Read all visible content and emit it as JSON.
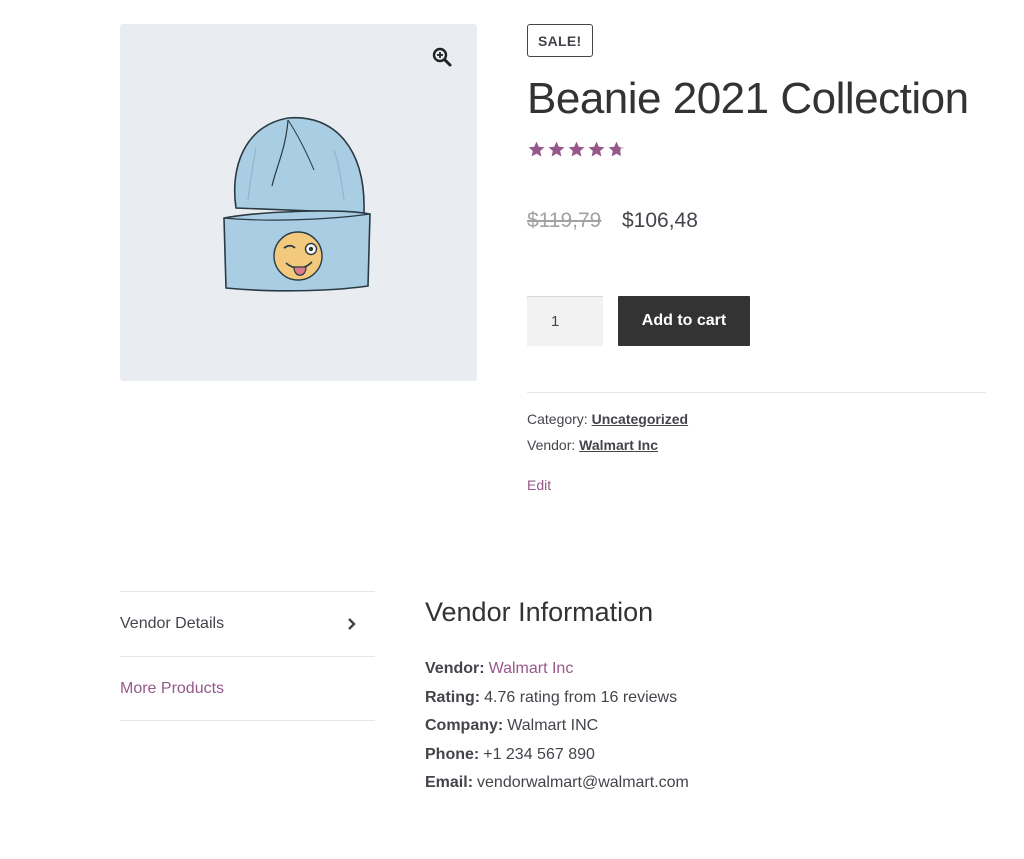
{
  "product": {
    "badge": "SALE!",
    "title": "Beanie 2021 Collection",
    "rating_stars": 4.76,
    "price_old": "$119,79",
    "price_new": "$106,48",
    "quantity": "1",
    "add_to_cart_label": "Add to cart"
  },
  "meta": {
    "category_label": "Category:",
    "category_value": "Uncategorized",
    "vendor_label": "Vendor:",
    "vendor_value": "Walmart Inc",
    "edit_label": "Edit"
  },
  "tabs": [
    {
      "label": "Vendor Details"
    },
    {
      "label": "More Products"
    }
  ],
  "vendor_info": {
    "heading": "Vendor Information",
    "rows": [
      {
        "label": "Vendor:",
        "value": "Walmart Inc"
      },
      {
        "label": "Rating:",
        "value": "4.76 rating from 16 reviews"
      },
      {
        "label": "Company:",
        "value": "Walmart INC"
      },
      {
        "label": "Phone:",
        "value": "+1 234 567 890"
      },
      {
        "label": "Email:",
        "value": "vendorwalmart@walmart.com"
      }
    ]
  },
  "icons": {
    "zoom": "zoom-in-icon",
    "chevron": "chevron-right-icon",
    "star": "star-icon"
  },
  "colors": {
    "accent": "#96588a",
    "text": "#43454b",
    "button_bg": "#333333",
    "gallery_bg": "#e9edf1"
  }
}
